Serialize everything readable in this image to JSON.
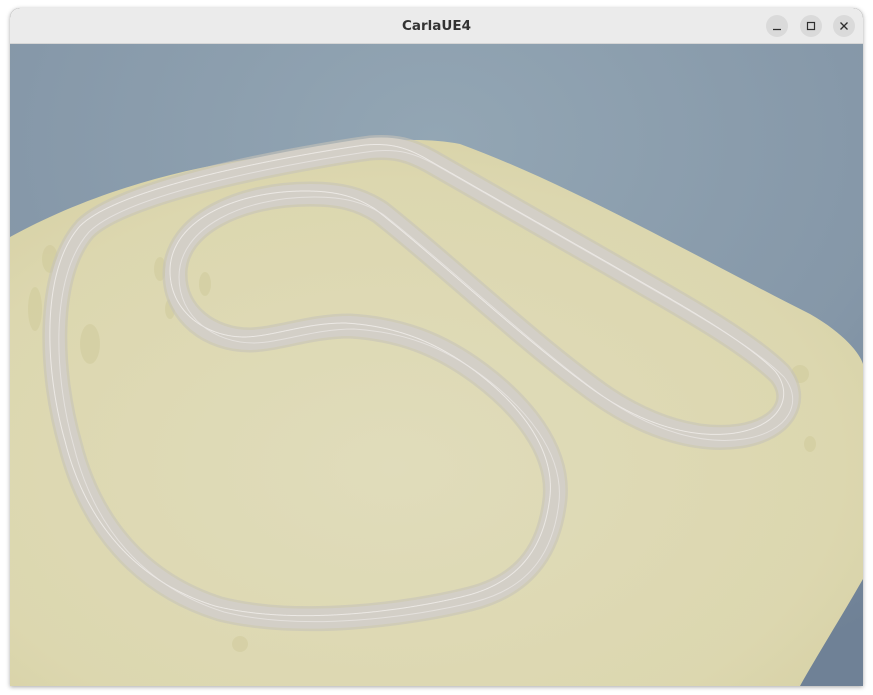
{
  "window": {
    "title": "CarlaUE4",
    "controls": {
      "minimize": "minimize-icon",
      "maximize": "maximize-icon",
      "close": "close-icon"
    }
  },
  "scene": {
    "colors": {
      "sky": "#8a9dad",
      "ground": "#ddd9b2",
      "track": "#d3cfc7",
      "track_edge": "#ece9e6"
    }
  }
}
